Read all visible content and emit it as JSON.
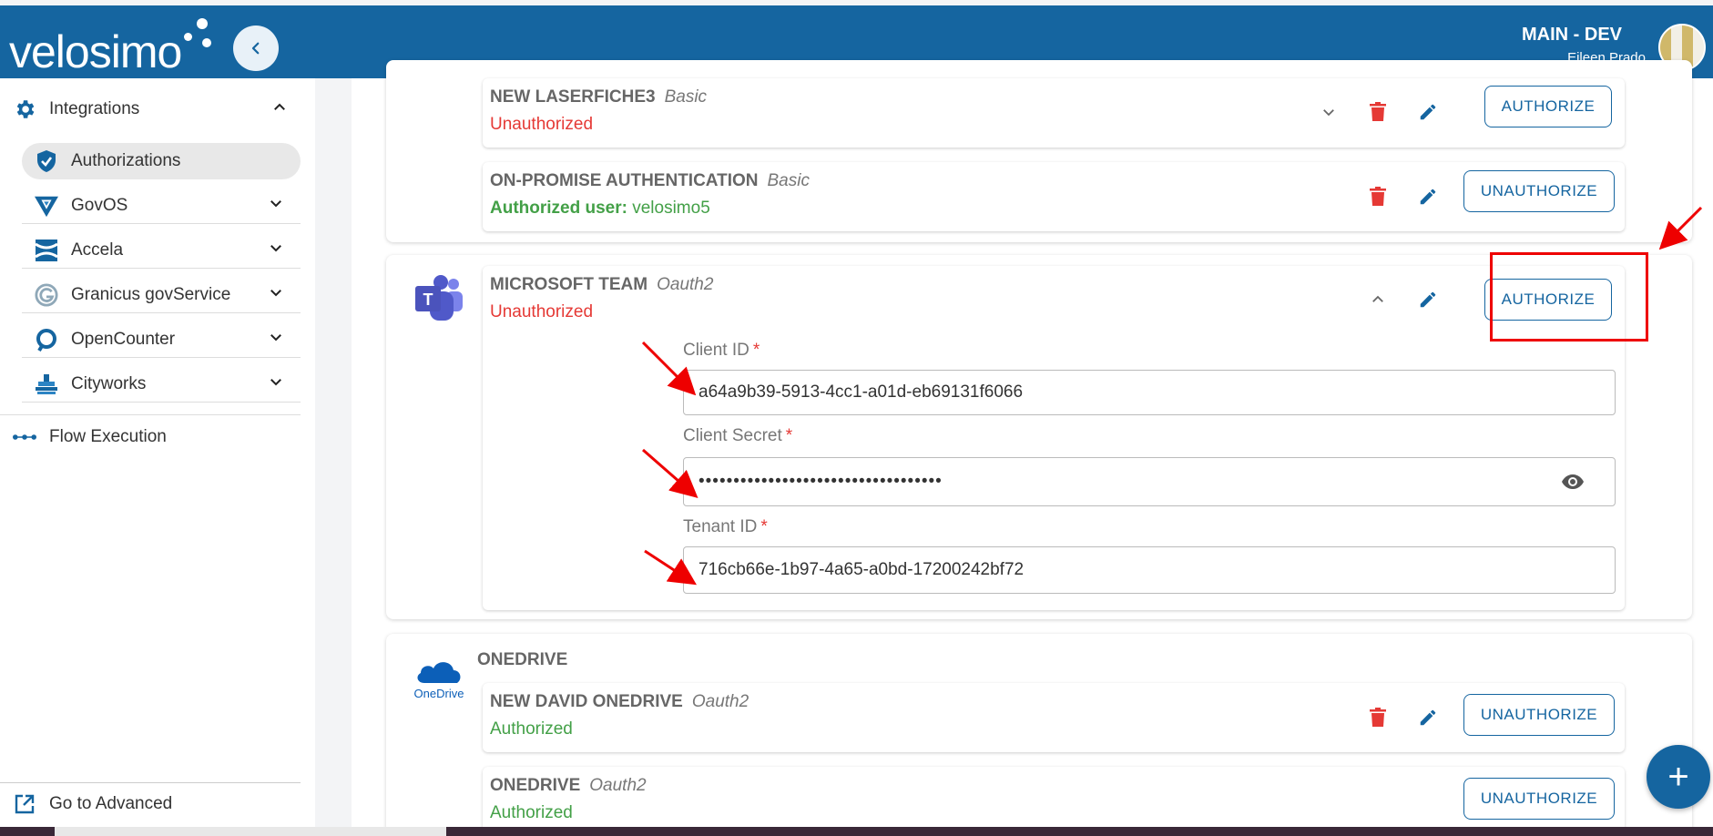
{
  "header": {
    "logo_text": "velosimo",
    "environment": "MAIN - DEV",
    "user_name": "Eileen Prado",
    "collapse_icon": "chevron-left-icon"
  },
  "sidebar": {
    "group": {
      "label": "Integrations",
      "icon": "gear-icon",
      "expanded": true
    },
    "items": [
      {
        "label": "Authorizations",
        "icon": "shield-check-icon",
        "active": true
      },
      {
        "label": "GovOS",
        "icon": "govos-logo-icon"
      },
      {
        "label": "Accela",
        "icon": "accela-logo-icon"
      },
      {
        "label": "Granicus govService",
        "icon": "granicus-logo-icon"
      },
      {
        "label": "OpenCounter",
        "icon": "opencounter-logo-icon"
      },
      {
        "label": "Cityworks",
        "icon": "cityworks-logo-icon"
      }
    ],
    "flow_execution": "Flow Execution",
    "go_advanced": "Go to Advanced"
  },
  "main": {
    "cards": {
      "laserfiche": {
        "title": "NEW LASERFICHE3",
        "type": "Basic",
        "status": "Unauthorized",
        "button": "AUTHORIZE"
      },
      "onpremise": {
        "title": "ON-PROMISE AUTHENTICATION",
        "type": "Basic",
        "status_prefix": "Authorized user:",
        "status_value": "velosimo5",
        "button": "UNAUTHORIZE"
      },
      "msteam": {
        "title": "MICROSOFT TEAM",
        "type": "Oauth2",
        "status": "Unauthorized",
        "button": "AUTHORIZE",
        "fields": {
          "client_id_label": "Client ID",
          "client_id_value": "a64a9b39-5913-4cc1-a01d-eb69131f6066",
          "client_secret_label": "Client Secret",
          "client_secret_value": "•••••••••••••••••••••••••••••••••••",
          "tenant_id_label": "Tenant ID",
          "tenant_id_value": "716cb66e-1b97-4a65-a0bd-17200242bf72",
          "required_mark": "*"
        }
      },
      "onedrive_group": {
        "label": "ONEDRIVE",
        "logo_text": "OneDrive"
      },
      "david_onedrive": {
        "title": "NEW DAVID ONEDRIVE",
        "type": "Oauth2",
        "status": "Authorized",
        "button": "UNAUTHORIZE"
      },
      "onedrive": {
        "title": "ONEDRIVE",
        "type": "Oauth2",
        "status": "Authorized",
        "button": "UNAUTHORIZE"
      }
    },
    "fab_label": "+"
  },
  "colors": {
    "brand": "#1565a0",
    "error": "#e53935",
    "success": "#43a047",
    "annotation": "#e00000"
  }
}
